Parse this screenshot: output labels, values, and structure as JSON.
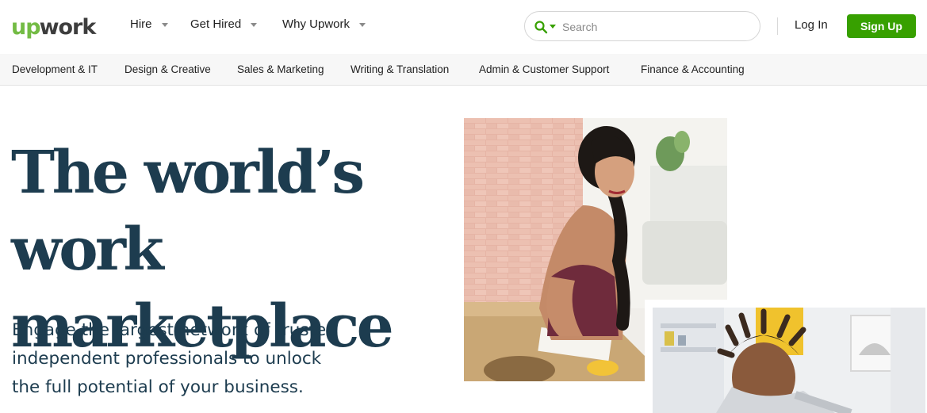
{
  "brand": {
    "logo_up": "up",
    "logo_work": "work",
    "primary_color": "#37a000",
    "logo_color": "#6fda44"
  },
  "nav": {
    "hire": "Hire",
    "get_hired": "Get Hired",
    "why_upwork": "Why Upwork"
  },
  "search": {
    "placeholder": "Search",
    "icon": "search-icon"
  },
  "auth": {
    "login": "Log In",
    "signup": "Sign Up"
  },
  "categories": [
    "Development & IT",
    "Design & Creative",
    "Sales & Marketing",
    "Writing & Translation",
    "Admin & Customer Support",
    "Finance & Accounting"
  ],
  "hero": {
    "headline_line1": "The world’s work",
    "headline_line2": "marketplace",
    "subtitle_line1": "Engage the largest network of trusted",
    "subtitle_line2": "independent professionals to unlock",
    "subtitle_line3": "the full potential of your business.",
    "text_color": "#1d3c4f"
  }
}
